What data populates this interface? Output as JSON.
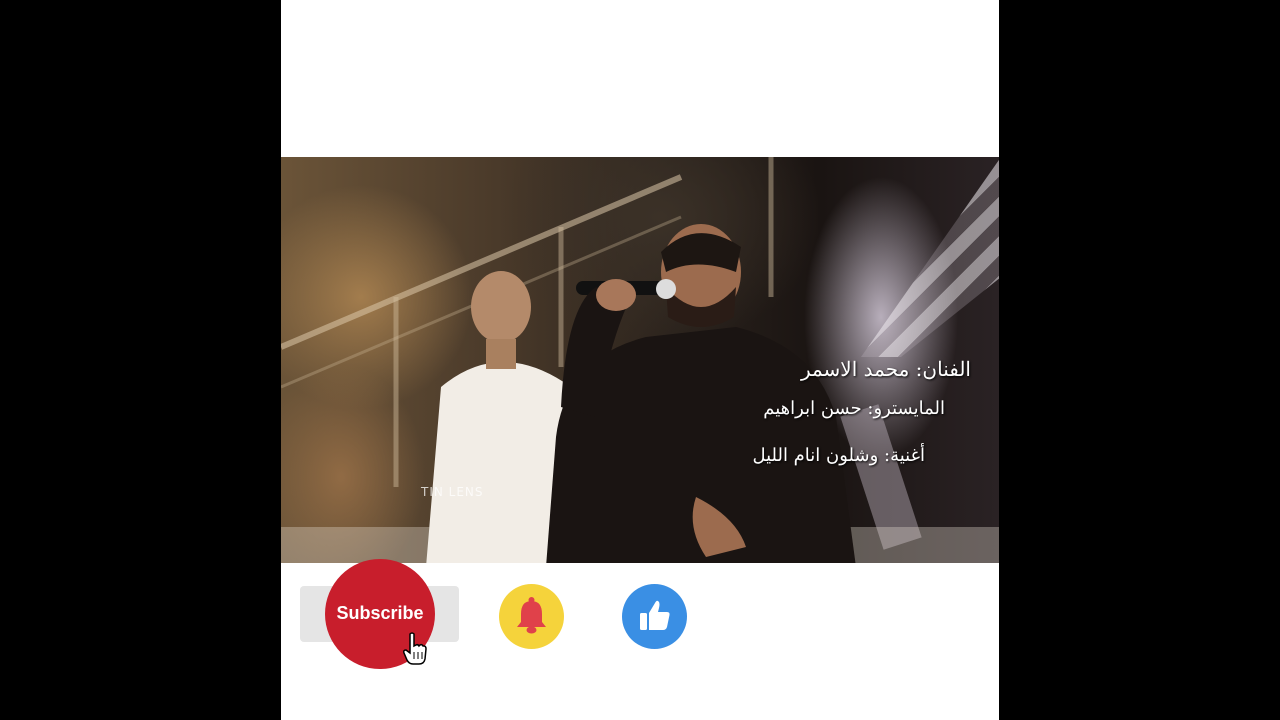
{
  "video": {
    "caption_artist": "الفنان: محمد الاسمر",
    "caption_maestro": "المايسترو: حسن ابراهيم",
    "caption_song": "أغنية: وشلون انام الليل",
    "watermark": "TIN LENS"
  },
  "actions": {
    "subscribe_label": "Subscribe",
    "bell_icon": "bell-icon",
    "like_icon": "thumbs-up-icon",
    "cursor_icon": "hand-pointer-icon"
  },
  "colors": {
    "subscribe_red": "#c81e2c",
    "bell_yellow": "#f5d33b",
    "like_blue": "#3a8fe4"
  }
}
